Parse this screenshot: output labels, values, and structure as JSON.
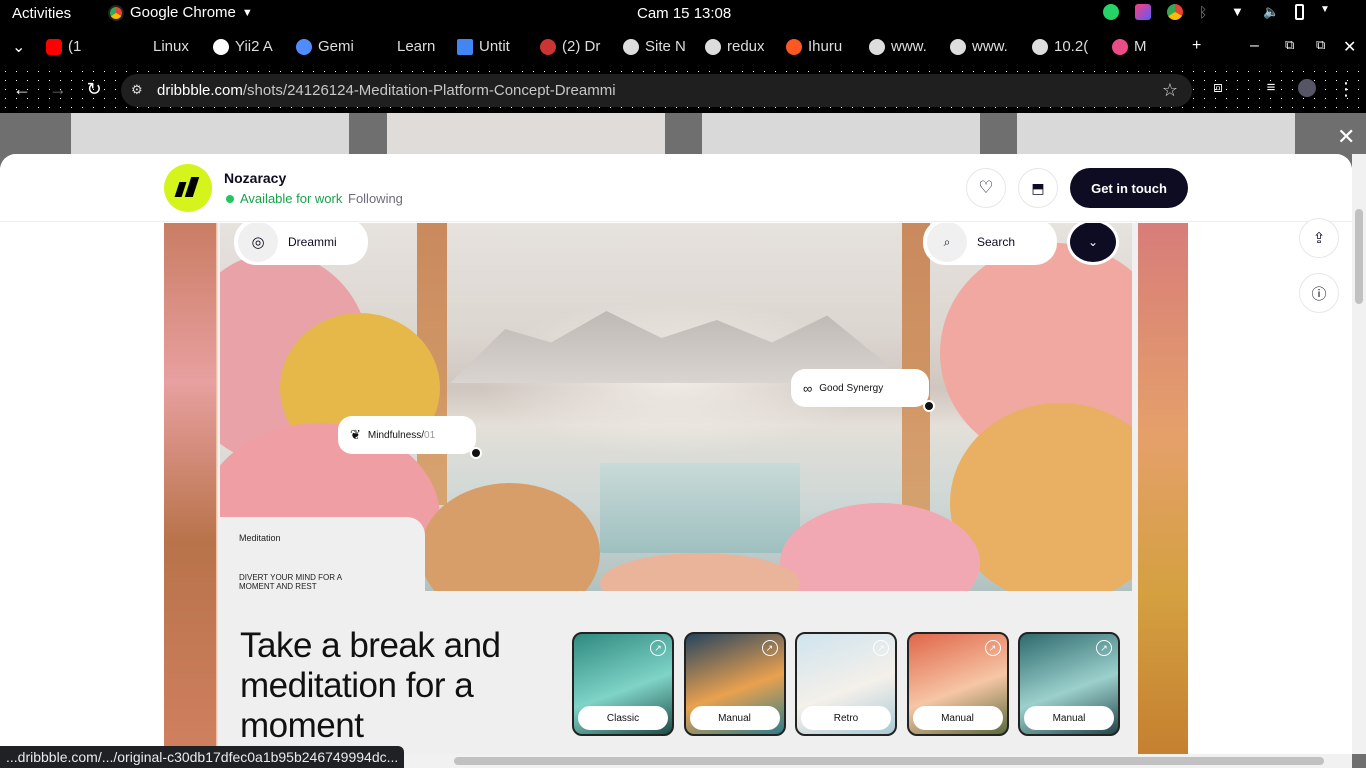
{
  "system": {
    "activities": "Activities",
    "app_name": "Google Chrome",
    "clock": "Cam 15  13:08"
  },
  "tabs": [
    {
      "label": "(1",
      "icon": "youtube-icon",
      "color": "#ff0000"
    },
    {
      "label": "Linux",
      "icon": "page-icon",
      "color": "#000000"
    },
    {
      "label": "Yii2 A",
      "icon": "openai-icon",
      "color": "#ffffff"
    },
    {
      "label": "Gemi",
      "icon": "gemini-icon",
      "color": "#4f8cff"
    },
    {
      "label": "Learn",
      "icon": "page-icon",
      "color": "#000000"
    },
    {
      "label": "Untit",
      "icon": "docs-icon",
      "color": "#4285f4"
    },
    {
      "label": "(2) Dr",
      "icon": "dribbble-icon",
      "color": "#c33"
    },
    {
      "label": "Site N",
      "icon": "globe-icon",
      "color": "#ddd"
    },
    {
      "label": "redux",
      "icon": "globe-icon",
      "color": "#ddd"
    },
    {
      "label": "Ihuru",
      "icon": "sun-icon",
      "color": "#ff5722"
    },
    {
      "label": "www.",
      "icon": "globe-icon",
      "color": "#ddd"
    },
    {
      "label": "www.",
      "icon": "globe-icon",
      "color": "#ddd"
    },
    {
      "label": "10.2(",
      "icon": "globe-icon",
      "color": "#ddd"
    },
    {
      "label": "M",
      "icon": "dribbble-icon",
      "color": "#ea4c89"
    }
  ],
  "address": {
    "domain": "dribbble.com",
    "path": "/shots/24126124-Meditation-Platform-Concept-Dreammi"
  },
  "header": {
    "designer": "Nozaracy",
    "availability": "Available for work",
    "following": "Following",
    "cta": "Get in touch"
  },
  "shot": {
    "brand": "Dreammi",
    "search": "Search",
    "tag_synergy": "Good Synergy",
    "tag_mindfulness": "Mindfulness/",
    "tag_mindfulness_num": "01",
    "section": "Meditation",
    "subtitle": "DIVERT YOUR MIND FOR A MOMENT AND REST",
    "headline": "Take a break and meditation for a moment",
    "cards": [
      {
        "label": "Classic",
        "colors": [
          "#2f8a7f",
          "#7fd3c7",
          "#1e4d48"
        ]
      },
      {
        "label": "Manual",
        "colors": [
          "#26445f",
          "#e9a14f",
          "#2b7d8a"
        ]
      },
      {
        "label": "Retro",
        "colors": [
          "#cfe4ee",
          "#f4f0ea",
          "#a9c9d6"
        ]
      },
      {
        "label": "Manual",
        "colors": [
          "#e0664a",
          "#f6c6a5",
          "#5a6a3a"
        ]
      },
      {
        "label": "Manual",
        "colors": [
          "#2f6a6e",
          "#9bd0cc",
          "#24454a"
        ]
      }
    ]
  },
  "status_url": "...dribbble.com/.../original-c30db17dfec0a1b95b246749994dc..."
}
